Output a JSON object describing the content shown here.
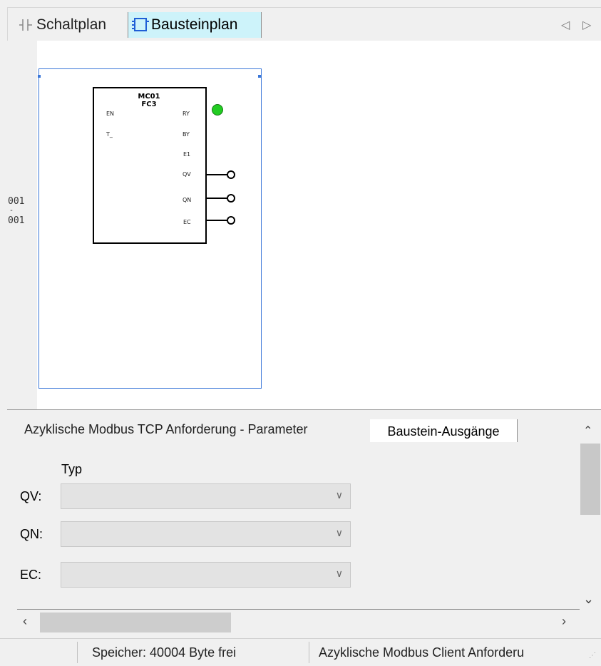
{
  "tabs": {
    "schaltplan": "Schaltplan",
    "bausteinplan": "Bausteinplan"
  },
  "diagram": {
    "row_start": "001",
    "row_sep": "-",
    "row_end": "001",
    "block": {
      "name": "MC01",
      "type": "FC3",
      "inputs": [
        "EN",
        "T_"
      ],
      "outputs": [
        "RY",
        "BY",
        "E1",
        "QV",
        "QN",
        "EC"
      ]
    },
    "status_led_color": "#22cc22"
  },
  "panel": {
    "tab_params": "Azyklische Modbus TCP Anforderung - Parameter",
    "tab_outputs": "Baustein-Ausgänge",
    "column_header": "Typ",
    "rows": [
      {
        "label": "QV:",
        "value": ""
      },
      {
        "label": "QN:",
        "value": ""
      },
      {
        "label": "EC:",
        "value": ""
      }
    ]
  },
  "status": {
    "memory": "Speicher: 40004 Byte frei",
    "context": "Azyklische Modbus Client Anforderu"
  },
  "colors": {
    "active_tab_bg": "#cdf3fa",
    "rung_border": "#3b77d8"
  }
}
